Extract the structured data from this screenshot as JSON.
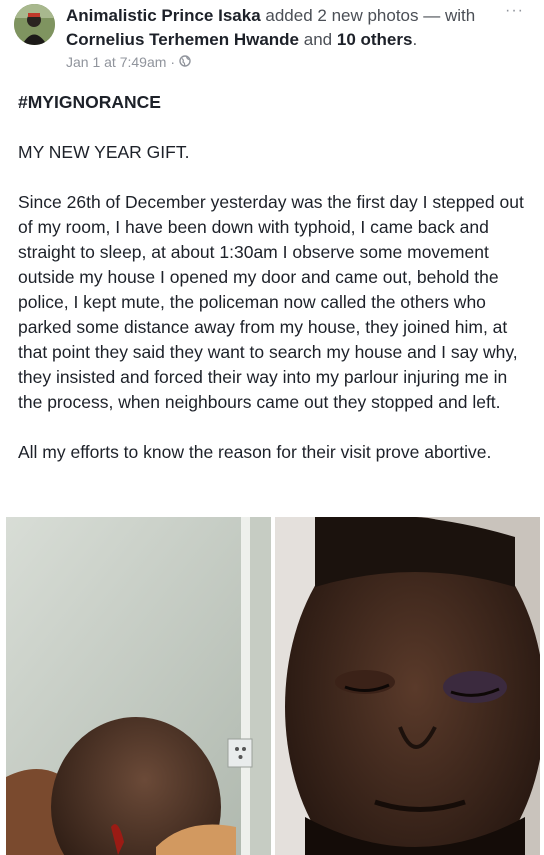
{
  "post": {
    "author": "Animalistic Prince Isaka",
    "action_text": "added 2 new photos —",
    "with_prefix": "with",
    "tagged_person": "Cornelius Terhemen Hwande",
    "and_text": "and",
    "others_text": "10 others",
    "end_period": ".",
    "timestamp": "Jan 1 at 7:49am",
    "privacy_icon": "globe-icon",
    "more_icon": "more-options-icon",
    "more_label": "···"
  },
  "content": {
    "hashtag": "#MYIGNORANCE",
    "heading": "MY NEW YEAR GIFT.",
    "paragraph_1": "Since 26th of December yesterday was the first day I stepped out of my room, I have been down with typhoid, I came back and straight to sleep, at about 1:30am I observe some movement outside my house I opened my door and came out, behold the police, I kept mute, the policeman now called the others who parked some distance away from my house, they joined him, at that point they said they want to search my house and I say why, they insisted and forced their way into my parlour injuring me in the process, when neighbours came out they stopped and left.",
    "paragraph_2": "All my efforts to know the reason for their visit prove abortive."
  },
  "photos": {
    "count": 2
  },
  "colors": {
    "text_primary": "#1d2129",
    "text_secondary": "#90949c",
    "header_gray": "#4b4f56"
  }
}
